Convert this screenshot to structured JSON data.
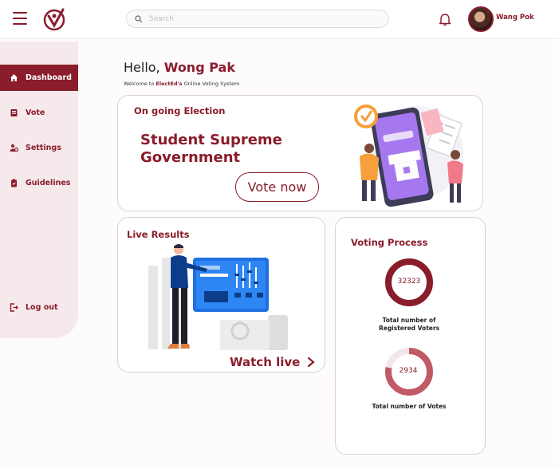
{
  "header": {
    "search_placeholder": "Search",
    "user_name": "Wang Pok",
    "icons": [
      "menu-icon",
      "logo-icon",
      "search-icon",
      "bell-icon",
      "avatar"
    ]
  },
  "sidebar": {
    "items": [
      {
        "label": "Dashboard",
        "icon": "home-icon",
        "active": true
      },
      {
        "label": "Vote",
        "icon": "ballot-icon",
        "active": false
      },
      {
        "label": "Settings",
        "icon": "settings-icon",
        "active": false
      },
      {
        "label": "Guidelines",
        "icon": "guidelines-icon",
        "active": false
      }
    ],
    "logout_label": "Log out"
  },
  "greeting": {
    "hello": "Hello,",
    "name": "Wong Pak",
    "welcome_prefix": "Welcome to",
    "brand": "ElectEd's",
    "welcome_suffix": "Online Voting System"
  },
  "election_card": {
    "title": "On going Election",
    "election_name": "Student Supreme Government",
    "vote_button": "Vote now"
  },
  "live_results": {
    "title": "Live Results",
    "watch_label": "Watch live"
  },
  "voting_process": {
    "title": "Voting Process",
    "registered_value": "32323",
    "registered_label": "Total number of Registered Voters",
    "votes_value": "2934",
    "votes_label": "Total number of Votes",
    "votes_fraction": 0.78
  },
  "colors": {
    "accent": "#8a1c2b",
    "accent_light": "#c05a66",
    "sidebar_bg": "#f6e9eb"
  }
}
